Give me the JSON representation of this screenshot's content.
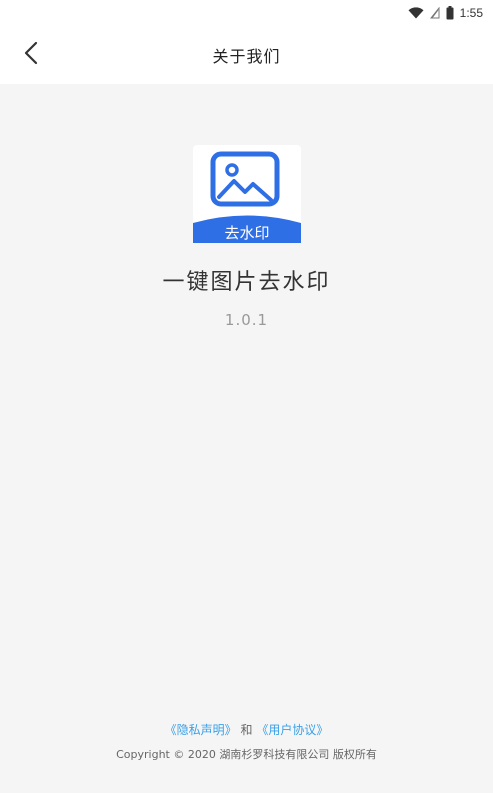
{
  "status_bar": {
    "time": "1:55",
    "icons": [
      "wifi-icon",
      "signal-icon",
      "battery-icon"
    ]
  },
  "header": {
    "title": "关于我们",
    "back_icon": "chevron-left-icon"
  },
  "app": {
    "logo_badge": "去水印",
    "name": "一键图片去水印",
    "version": "1.0.1"
  },
  "footer": {
    "privacy_link": "《隐私声明》",
    "conjunction": "和",
    "terms_link": "《用户协议》",
    "copyright": "Copyright © 2020 湖南杉罗科技有限公司 版权所有"
  },
  "colors": {
    "accent": "#2f6fe6",
    "link": "#3aa0e8",
    "background": "#f5f5f5"
  }
}
